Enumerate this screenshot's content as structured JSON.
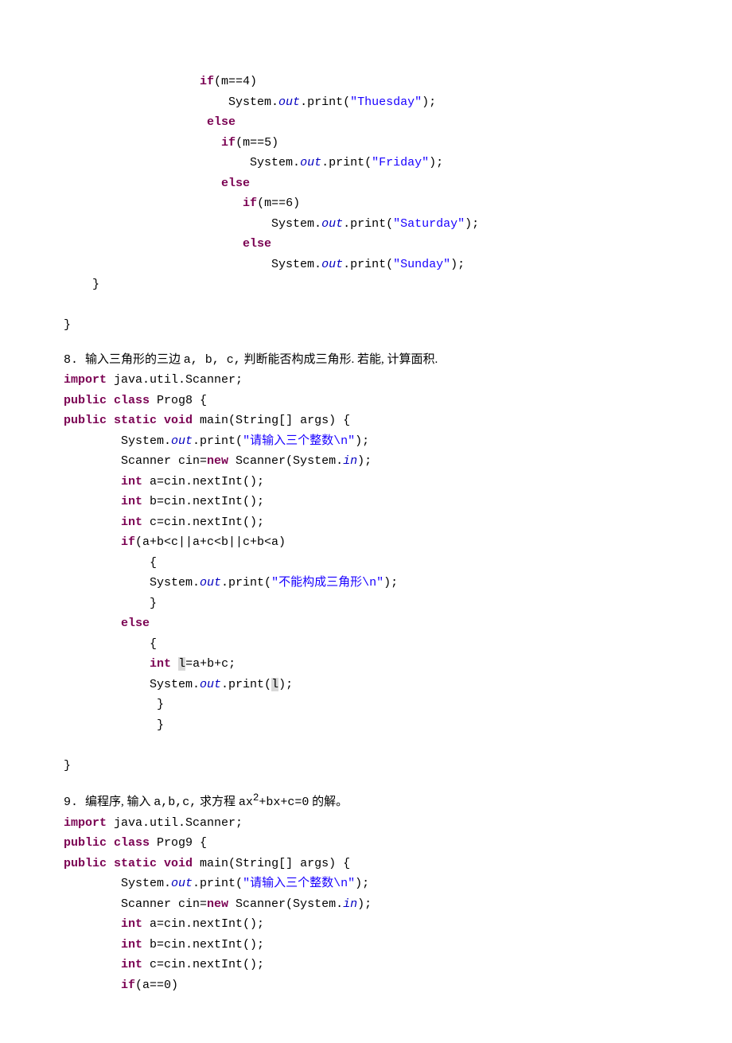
{
  "block1": {
    "l1a": "                   ",
    "l1_if": "if",
    "l1b": "(m==4)",
    "l2a": "                       System.",
    "l2_out": "out",
    "l2b": ".print(",
    "l2_str": "\"Thuesday\"",
    "l2c": ");",
    "l3a": "                    ",
    "l3_else": "else",
    "l4a": "                      ",
    "l4_if": "if",
    "l4b": "(m==5)",
    "l5a": "                          System.",
    "l5_out": "out",
    "l5b": ".print(",
    "l5_str": "\"Friday\"",
    "l5c": ");",
    "l6a": "                      ",
    "l6_else": "else",
    "l7a": "                         ",
    "l7_if": "if",
    "l7b": "(m==6)",
    "l8a": "                             System.",
    "l8_out": "out",
    "l8b": ".print(",
    "l8_str": "\"Saturday\"",
    "l8c": ");",
    "l9a": "                         ",
    "l9_else": "else",
    "l10a": "                             System.",
    "l10_out": "out",
    "l10b": ".print(",
    "l10_str": "\"Sunday\"",
    "l10c": ");",
    "l11": "    }",
    "l12": "",
    "l13": "}"
  },
  "q8": {
    "num": "8.  ",
    "text1": "输入三角形的三边 ",
    "abc": "a, b, c,",
    "text2": "  判断能否构成三角形.  若能,  计算面积."
  },
  "code8": {
    "l1_imp": "import",
    "l1b": " java.util.Scanner;",
    "l2_pub": "public",
    "l2_cls": " class",
    "l2b": " Prog8 {",
    "l3_pub": "public",
    "l3_stat": " static",
    "l3_void": " void",
    "l3b": " main(String[] args) {",
    "l4a": "        System.",
    "l4_out": "out",
    "l4b": ".print(",
    "l4_str": "\"请输入三个整数\\n\"",
    "l4c": ");",
    "l5a": "        Scanner cin=",
    "l5_new": "new",
    "l5b": " Scanner(System.",
    "l5_in": "in",
    "l5c": ");",
    "l6a": "        ",
    "l6_int": "int",
    "l6b": " a=cin.nextInt();",
    "l7a": "        ",
    "l7_int": "int",
    "l7b": " b=cin.nextInt();",
    "l8a": "        ",
    "l8_int": "int",
    "l8b": " c=cin.nextInt();",
    "l9a": "        ",
    "l9_if": "if",
    "l9b": "(a+b<c||a+c<b||c+b<a)",
    "l10": "            {",
    "l11a": "            System.",
    "l11_out": "out",
    "l11b": ".print(",
    "l11_str": "\"不能构成三角形\\n\"",
    "l11c": ");",
    "l12": "            }",
    "l13a": "        ",
    "l13_else": "else",
    "l14": "            {",
    "l15a": "            ",
    "l15_int": "int",
    "l15b": " ",
    "l15_hl": "l",
    "l15c": "=a+b+c;",
    "l16a": "            System.",
    "l16_out": "out",
    "l16b": ".print(",
    "l16_hl": "l",
    "l16c": ");",
    "l17": "             }",
    "l18": "             }",
    "l19": "",
    "l20": "}"
  },
  "q9": {
    "num": "9.  ",
    "text1": "编程序,  输入 ",
    "abc": "a,b,c,",
    "text2": "  求方程 ",
    "eq1": "ax",
    "sup": "2",
    "eq2": "+bx+c=0",
    "text3": " 的解。"
  },
  "code9": {
    "l1_imp": "import",
    "l1b": " java.util.Scanner;",
    "l2_pub": "public",
    "l2_cls": " class",
    "l2b": " Prog9 {",
    "l3_pub": "public",
    "l3_stat": " static",
    "l3_void": " void",
    "l3b": " main(String[] args) {",
    "l4a": "        System.",
    "l4_out": "out",
    "l4b": ".print(",
    "l4_str": "\"请输入三个整数\\n\"",
    "l4c": ");",
    "l5a": "        Scanner cin=",
    "l5_new": "new",
    "l5b": " Scanner(System.",
    "l5_in": "in",
    "l5c": ");",
    "l6a": "        ",
    "l6_int": "int",
    "l6b": " a=cin.nextInt();",
    "l7a": "        ",
    "l7_int": "int",
    "l7b": " b=cin.nextInt();",
    "l8a": "        ",
    "l8_int": "int",
    "l8b": " c=cin.nextInt();",
    "l9a": "        ",
    "l9_if": "if",
    "l9b": "(a==0)"
  }
}
